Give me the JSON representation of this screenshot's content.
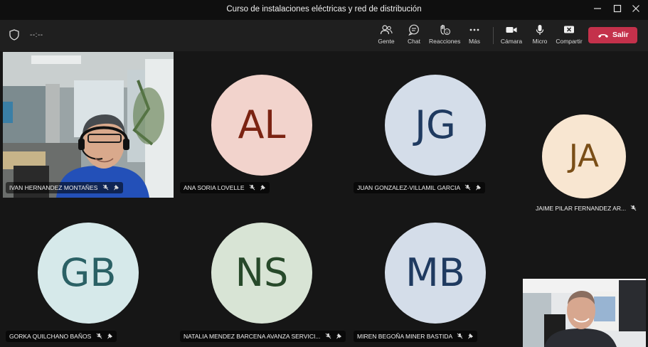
{
  "window": {
    "title": "Curso de instalaciones eléctricas y red de distribución"
  },
  "toolbar": {
    "timer": "--:--",
    "buttons": [
      {
        "label": "Gente"
      },
      {
        "label": "Chat"
      },
      {
        "label": "Reacciones"
      },
      {
        "label": "Más"
      },
      {
        "label": "Cámara"
      },
      {
        "label": "Micro"
      },
      {
        "label": "Compartir"
      }
    ],
    "leave_label": "Salir"
  },
  "participants": [
    {
      "name": "IVAN HERNANDEZ MONTAÑES",
      "video": true
    },
    {
      "name": "ANA SORIA LOVELLE",
      "initials": "AL",
      "avatar_bg": "#f2d3cc",
      "avatar_fg": "#7b2312"
    },
    {
      "name": "JUAN GONZALEZ-VILLAMIL GARCIA",
      "initials": "JG",
      "avatar_bg": "#d4dde9",
      "avatar_fg": "#1f3a60"
    },
    {
      "name": "JAIME PILAR FERNANDEZ AR...",
      "initials": "JA",
      "avatar_bg": "#f8e6d1",
      "avatar_fg": "#7a4e17"
    },
    {
      "name": "GORKA QUILCHANO BAÑOS",
      "initials": "GB",
      "avatar_bg": "#d6e9ea",
      "avatar_fg": "#2b6165"
    },
    {
      "name": "NATALIA MENDEZ BARCENA AVANZA SERVICI...",
      "initials": "NS",
      "avatar_bg": "#d8e4d5",
      "avatar_fg": "#27492a"
    },
    {
      "name": "MIREN BEGOÑA MINER BASTIDA",
      "initials": "MB",
      "avatar_bg": "#d4dde9",
      "avatar_fg": "#1f3a60"
    }
  ],
  "self_view": {
    "video": true
  },
  "colors": {
    "accent_leave": "#c4314b",
    "stage_bg": "#161616",
    "toolbar_bg": "#1f1f1f"
  }
}
